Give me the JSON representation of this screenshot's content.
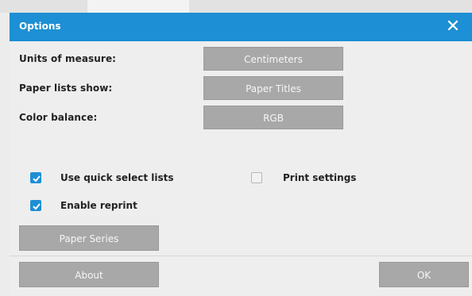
{
  "dialog": {
    "title": "Options",
    "close_symbol": "✕"
  },
  "settings": {
    "units": {
      "label": "Units of measure:",
      "value": "Centimeters"
    },
    "paper_lists": {
      "label": "Paper lists show:",
      "value": "Paper Titles"
    },
    "color_balance": {
      "label": "Color balance:",
      "value": "RGB"
    }
  },
  "checkboxes": {
    "quick_select": {
      "label": "Use quick select lists",
      "checked": true
    },
    "enable_reprint": {
      "label": "Enable reprint",
      "checked": true
    },
    "print_settings": {
      "label": "Print settings",
      "checked": false
    }
  },
  "buttons": {
    "paper_series": "Paper Series",
    "about": "About",
    "ok": "OK"
  },
  "colors": {
    "accent": "#1d8fd4",
    "button_gray": "#a8a8a8",
    "background": "#eeeeee"
  }
}
